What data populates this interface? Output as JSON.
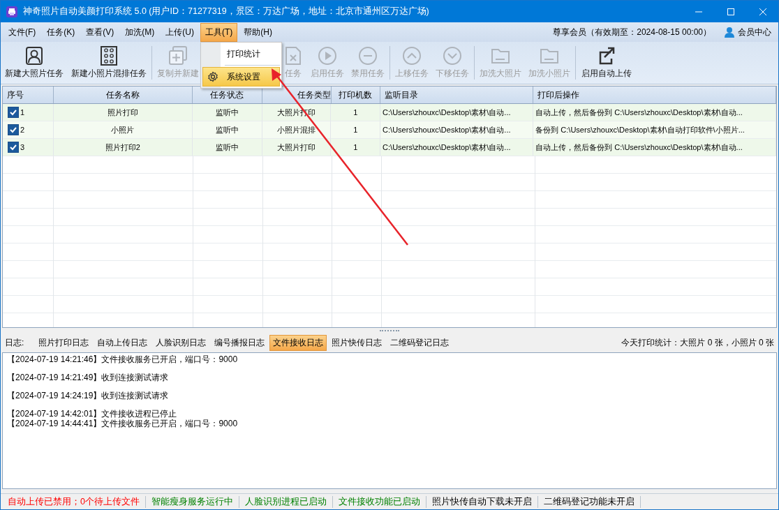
{
  "window": {
    "title": "神奇照片自动美颜打印系统 5.0 (用户ID：71277319，景区：万达广场，地址：北京市通州区万达广场)"
  },
  "menu": [
    {
      "label": "文件(F)",
      "selected": false
    },
    {
      "label": "任务(K)",
      "selected": false
    },
    {
      "label": "查看(V)",
      "selected": false
    },
    {
      "label": "加洗(M)",
      "selected": false
    },
    {
      "label": "上传(U)",
      "selected": false
    },
    {
      "label": "工具(T)",
      "selected": true
    },
    {
      "label": "帮助(H)",
      "selected": false
    }
  ],
  "membership": {
    "text": "尊享会员（有效期至：2024-08-15 00:00）",
    "link": "会员中心"
  },
  "dropdown": {
    "items": [
      {
        "label": "打印统计",
        "selected": false
      },
      {
        "label": "系统设置",
        "selected": true
      }
    ]
  },
  "toolbar": [
    {
      "label": "新建大照片任务",
      "disabled": false,
      "separator_before": false
    },
    {
      "label": "新建小照片混排任务",
      "disabled": false,
      "separator_before": false
    },
    {
      "label": "复制并新建",
      "disabled": true,
      "separator_before": true
    },
    {
      "label": "任务",
      "disabled": true,
      "separator_before": false
    },
    {
      "label": "启用任务",
      "disabled": true,
      "separator_before": false
    },
    {
      "label": "禁用任务",
      "disabled": true,
      "separator_before": false
    },
    {
      "label": "上移任务",
      "disabled": true,
      "separator_before": true
    },
    {
      "label": "下移任务",
      "disabled": true,
      "separator_before": false
    },
    {
      "label": "加洗大照片",
      "disabled": true,
      "separator_before": true
    },
    {
      "label": "加洗小照片",
      "disabled": true,
      "separator_before": false
    },
    {
      "label": "启用自动上传",
      "disabled": false,
      "separator_before": true
    }
  ],
  "table": {
    "columns": [
      "序号",
      "任务名称",
      "任务状态",
      "任务类型",
      "打印机数",
      "监听目录",
      "打印后操作"
    ],
    "rows": [
      {
        "checked": true,
        "cells": [
          "1",
          "照片打印",
          "监听中",
          "大照片打印",
          "1",
          "C:\\Users\\zhouxc\\Desktop\\素材\\自动...",
          "自动上传，然后备份到 C:\\Users\\zhouxc\\Desktop\\素材\\自动..."
        ]
      },
      {
        "checked": true,
        "cells": [
          "2",
          "小照片",
          "监听中",
          "小照片混排",
          "1",
          "C:\\Users\\zhouxc\\Desktop\\素材\\自动...",
          "备份到 C:\\Users\\zhouxc\\Desktop\\素材\\自动打印软件\\小照片..."
        ]
      },
      {
        "checked": true,
        "cells": [
          "3",
          "照片打印2",
          "监听中",
          "大照片打印",
          "1",
          "C:\\Users\\zhouxc\\Desktop\\素材\\自动...",
          "自动上传，然后备份到 C:\\Users\\zhouxc\\Desktop\\素材\\自动..."
        ]
      }
    ]
  },
  "log_tabs": {
    "label": "日志:",
    "tabs": [
      {
        "label": "照片打印日志",
        "selected": false
      },
      {
        "label": "自动上传日志",
        "selected": false
      },
      {
        "label": "人脸识别日志",
        "selected": false
      },
      {
        "label": "编号播报日志",
        "selected": false
      },
      {
        "label": "文件接收日志",
        "selected": true
      },
      {
        "label": "照片快传日志",
        "selected": false
      },
      {
        "label": "二维码登记日志",
        "selected": false
      }
    ],
    "summary": "今天打印统计：大照片 0 张，小照片 0 张"
  },
  "log": [
    {
      "text": "【2024-07-19 14:21:46】文件接收服务已开启，端口号：9000",
      "blank_after": true
    },
    {
      "text": "【2024-07-19 14:21:49】收到连接测试请求",
      "blank_after": true
    },
    {
      "text": "【2024-07-19 14:24:19】收到连接测试请求",
      "blank_after": true
    },
    {
      "text": "【2024-07-19 14:42:01】文件接收进程已停止",
      "blank_after": false
    },
    {
      "text": "【2024-07-19 14:44:41】文件接收服务已开启，端口号：9000",
      "blank_after": false
    }
  ],
  "status_bar": [
    {
      "text": "自动上传已禁用；0个待上传文件",
      "color": "#ff0000"
    },
    {
      "text": "智能瘦身服务运行中",
      "color": "#008000"
    },
    {
      "text": "人脸识别进程已启动",
      "color": "#008000"
    },
    {
      "text": "文件接收功能已启动",
      "color": "#008000"
    },
    {
      "text": "照片快传自动下载未开启",
      "color": "#000000"
    },
    {
      "text": "二维码登记功能未开启",
      "color": "#000000"
    }
  ]
}
